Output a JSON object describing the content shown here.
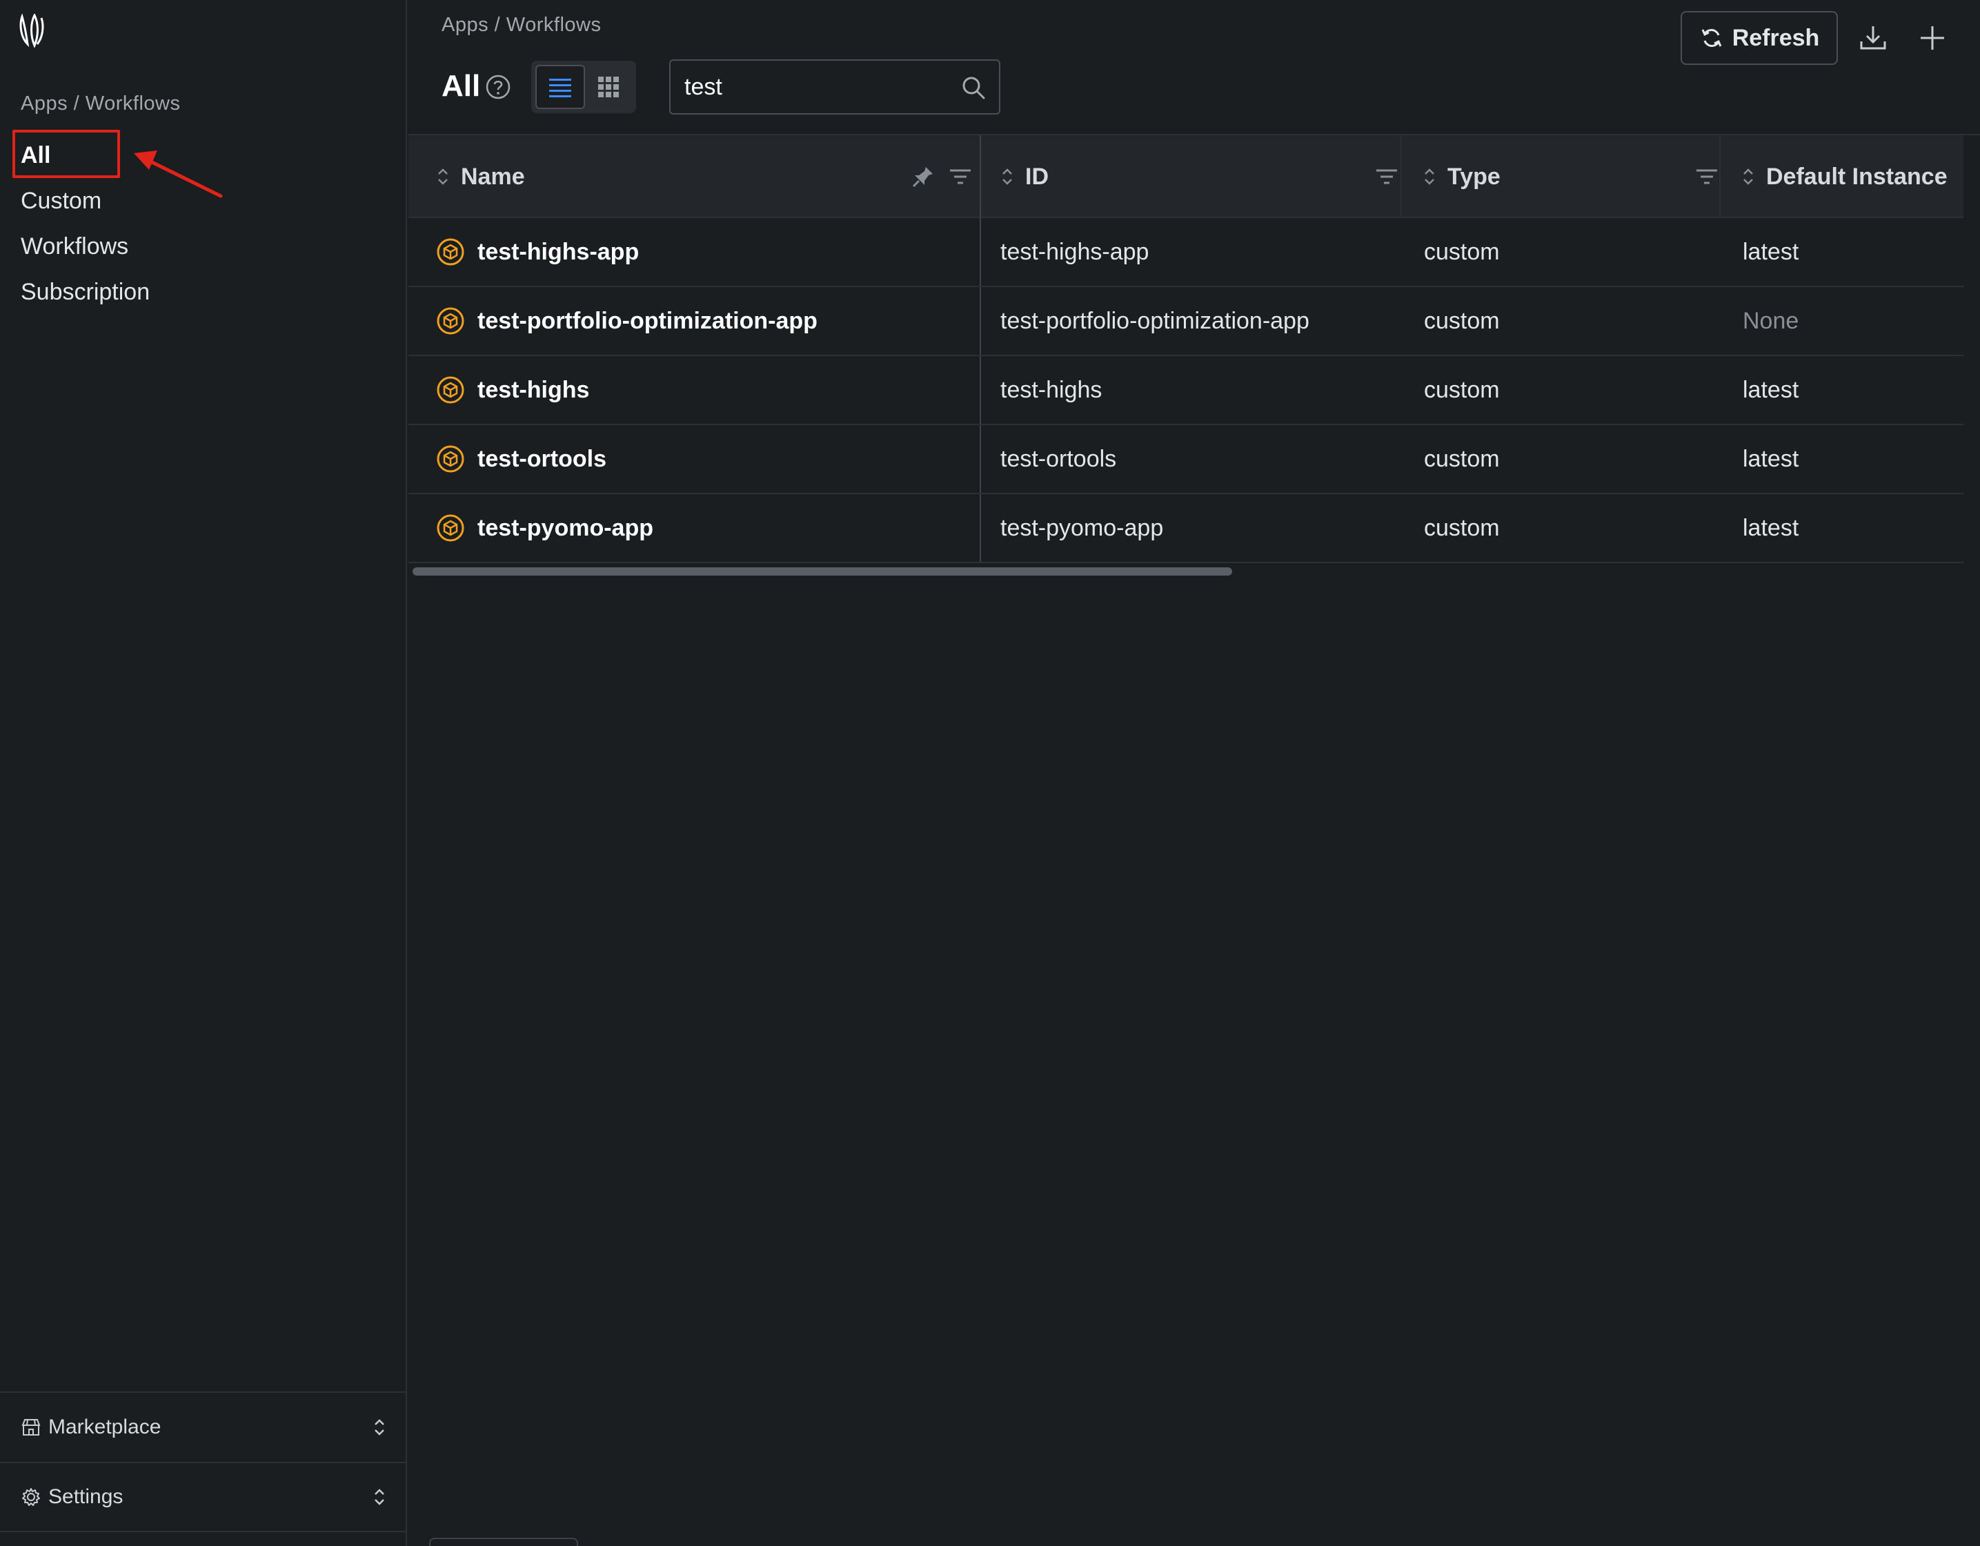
{
  "sidebar": {
    "title": "Apps / Workflows",
    "items": [
      {
        "label": "All",
        "active": true
      },
      {
        "label": "Custom",
        "active": false
      },
      {
        "label": "Workflows",
        "active": false
      },
      {
        "label": "Subscription",
        "active": false
      }
    ],
    "bottom": [
      {
        "label": "Marketplace",
        "icon": "storefront-icon"
      },
      {
        "label": "Settings",
        "icon": "gear-icon"
      }
    ]
  },
  "header": {
    "breadcrumb": "Apps / Workflows",
    "title": "All",
    "view_modes": [
      "list",
      "grid"
    ],
    "active_view": "list",
    "search_value": "test",
    "refresh_label": "Refresh"
  },
  "table": {
    "columns": [
      "Name",
      "ID",
      "Type",
      "Default Instance"
    ],
    "rows": [
      {
        "name": "test-highs-app",
        "id": "test-highs-app",
        "type": "custom",
        "default_instance": "latest"
      },
      {
        "name": "test-portfolio-optimization-app",
        "id": "test-portfolio-optimization-app",
        "type": "custom",
        "default_instance": "None"
      },
      {
        "name": "test-highs",
        "id": "test-highs",
        "type": "custom",
        "default_instance": "latest"
      },
      {
        "name": "test-ortools",
        "id": "test-ortools",
        "type": "custom",
        "default_instance": "latest"
      },
      {
        "name": "test-pyomo-app",
        "id": "test-pyomo-app",
        "type": "custom",
        "default_instance": "latest"
      }
    ]
  },
  "colors": {
    "background": "#1b1e21",
    "accent_blue": "#3d8bfd",
    "app_icon_orange": "#f0a020",
    "annotation_red": "#e2231a"
  }
}
